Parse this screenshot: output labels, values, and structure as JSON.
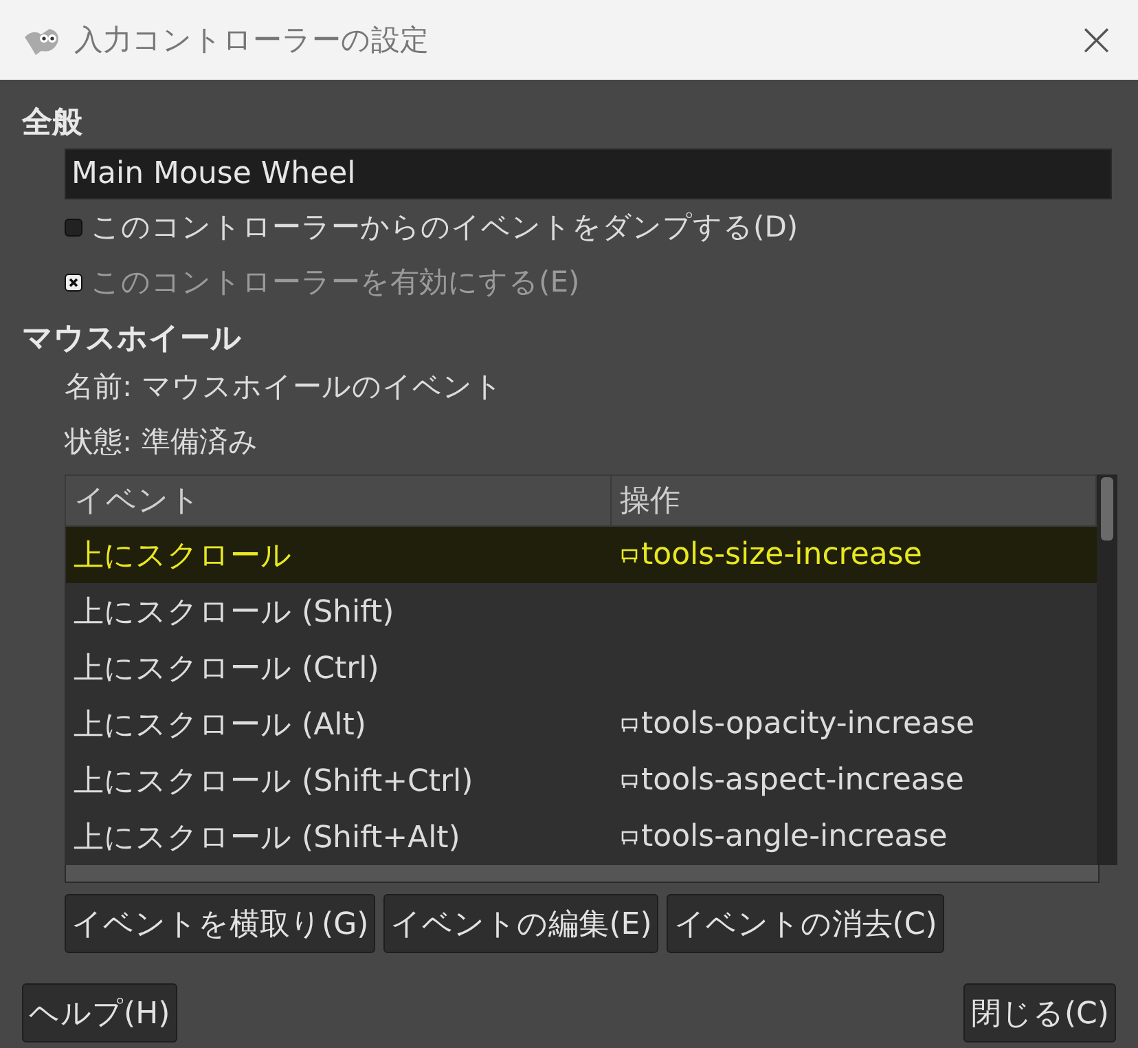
{
  "window": {
    "title": "入力コントローラーの設定",
    "close": "×"
  },
  "general": {
    "heading": "全般",
    "name_value": "Main Mouse Wheel",
    "checkboxes": [
      {
        "label": "このコントローラーからのイベントをダンプする(D)",
        "checked": false,
        "disabled": false
      },
      {
        "label": "このコントローラーを有効にする(E)",
        "checked": true,
        "disabled": true
      }
    ]
  },
  "mouse_wheel": {
    "heading": "マウスホイール",
    "name_line": "名前: マウスホイールのイベント",
    "state_line": "状態: 準備済み"
  },
  "table": {
    "columns": [
      "イベント",
      "操作"
    ],
    "rows": [
      {
        "event": "上にスクロール",
        "action": "tools-size-increase",
        "selected": true
      },
      {
        "event": "上にスクロール (Shift)",
        "selected": false
      },
      {
        "event": "上にスクロール (Ctrl)",
        "selected": false
      },
      {
        "event": "上にスクロール (Alt)",
        "action": "tools-opacity-increase",
        "selected": false
      },
      {
        "event": "上にスクロール (Shift+Ctrl)",
        "action": "tools-aspect-increase",
        "selected": false
      },
      {
        "event": "上にスクロール (Shift+Alt)",
        "action": "tools-angle-increase",
        "selected": false
      }
    ]
  },
  "event_buttons": [
    "イベントを横取り(G)",
    "イベントの編集(E)",
    "イベントの消去(C)"
  ],
  "footer_buttons": [
    "ヘルプ(H)",
    "閉じる(C)"
  ]
}
